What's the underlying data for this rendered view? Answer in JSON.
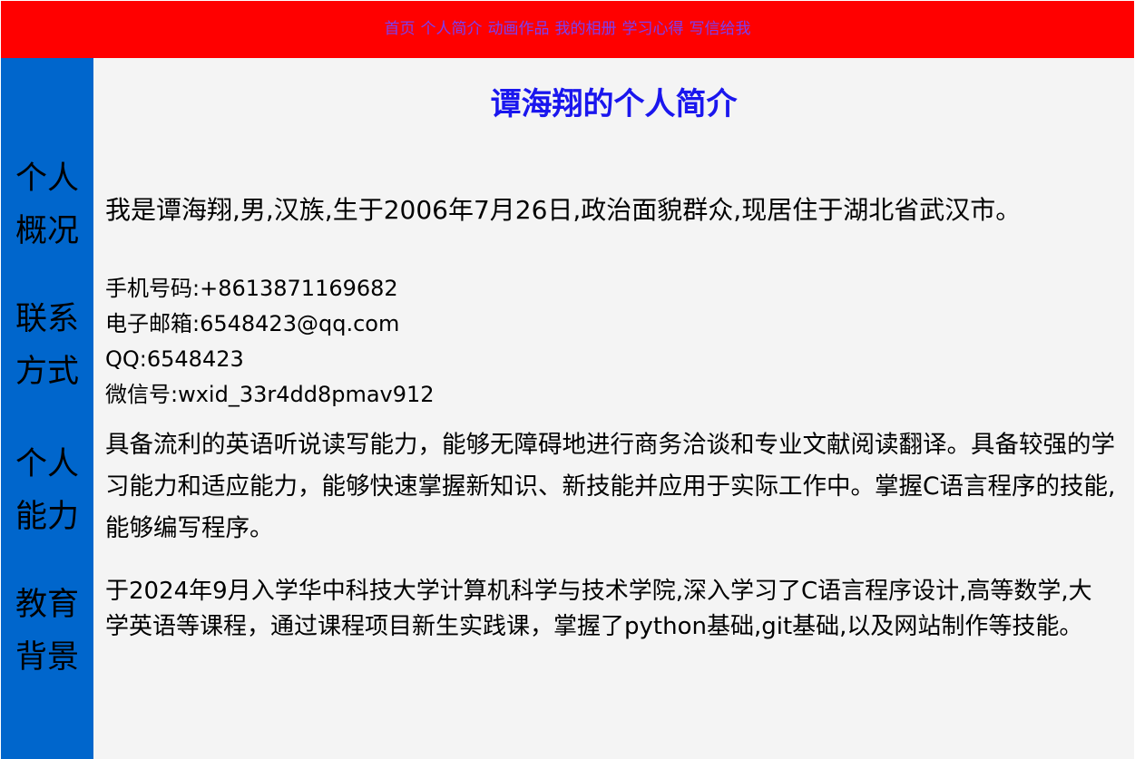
{
  "nav": {
    "items": [
      {
        "label": "首页"
      },
      {
        "label": "个人简介"
      },
      {
        "label": "动画作品"
      },
      {
        "label": "我的相册"
      },
      {
        "label": "学习心得"
      },
      {
        "label": "写信给我"
      }
    ]
  },
  "page": {
    "title": "谭海翔的个人简介"
  },
  "sections": {
    "overview": {
      "label_line1": "个人",
      "label_line2": "概况",
      "text": "我是谭海翔,男,汉族,生于2006年7月26日,政治面貌群众,现居住于湖北省武汉市。"
    },
    "contact": {
      "label_line1": "联系",
      "label_line2": "方式",
      "phone": "手机号码:+8613871169682",
      "email": "电子邮箱:6548423@qq.com",
      "qq": "QQ:6548423",
      "wechat": "微信号:wxid_33r4dd8pmav912"
    },
    "ability": {
      "label_line1": "个人",
      "label_line2": "能力",
      "text": "具备流利的英语听说读写能力，能够无障碍地进行商务洽谈和专业文献阅读翻译。具备较强的学习能力和适应能力，能够快速掌握新知识、新技能并应用于实际工作中。掌握C语言程序的技能,能够编写程序。"
    },
    "education": {
      "label_line1": "教育",
      "label_line2": "背景",
      "text": "于2024年9月入学华中科技大学计算机科学与技术学院,深入学习了C语言程序设计,高等数学,大学英语等课程，通过课程项目新生实践课，掌握了python基础,git基础,以及网站制作等技能。"
    }
  },
  "colors": {
    "nav_background": "#ff0000",
    "nav_link": "#7b3ff2",
    "sidebar": "#0066cc",
    "content_background": "#f4f4f4",
    "title": "#1a16ee"
  }
}
